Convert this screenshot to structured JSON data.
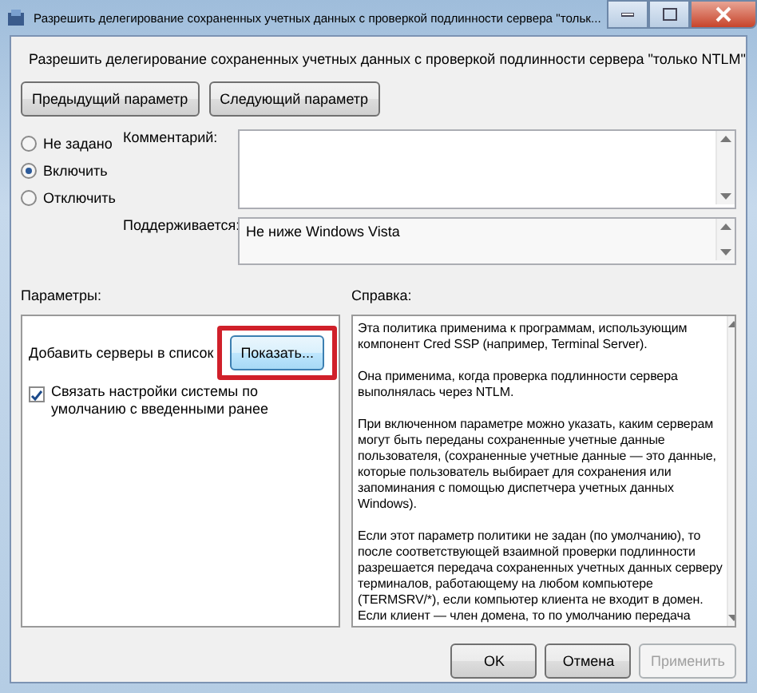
{
  "window": {
    "title": "Разрешить делегирование сохраненных учетных данных с проверкой подлинности сервера \"тольк..."
  },
  "header": {
    "title": "Разрешить делегирование сохраненных учетных данных с проверкой подлинности сервера \"только NTLM\""
  },
  "nav_buttons": [
    "Предыдущий параметр",
    "Следующий параметр"
  ],
  "state_options": [
    {
      "label": "Не задано",
      "selected": false
    },
    {
      "label": "Включить",
      "selected": true
    },
    {
      "label": "Отключить",
      "selected": false
    }
  ],
  "comment": {
    "label": "Комментарий:"
  },
  "supported": {
    "label": "Поддерживается:",
    "value": "Не ниже Windows Vista"
  },
  "parameters": {
    "label": "Параметры:",
    "servers_label": "Добавить серверы в список",
    "show_button": {
      "label": "Показать...",
      "highlighted": true
    },
    "merge": {
      "label": "Связать настройки системы по умолчанию с введенными ранее",
      "checked": true
    }
  },
  "help": {
    "label": "Справка:",
    "paragraphs": [
      "Эта политика применима к программам, использующим\nкомпонент Cred SSP (например, Terminal Server).",
      "Она применима, когда проверка подлинности сервера\nвыполнялась через NTLM.",
      "При включенном параметре можно указать, каким серверам\nмогут быть переданы сохраненные учетные данные\nпользователя, (сохраненные учетные данные — это данные,\nкоторые пользователь выбирает для сохранения или\nзапоминания с помощью диспетчера учетных данных\nWindows).",
      "Если этот параметр политики не задан (по умолчанию), то\nпосле соответствующей взаимной проверки подлинности\nразрешается передача сохраненных учетных данных серверу\nтерминалов, работающему на любом компьютере\n(TERMSRV/*), если компьютер клиента не входит в домен.\nЕсли клиент — член домена, то по умолчанию передача"
    ]
  },
  "footer_buttons": [
    {
      "label": "OK",
      "disabled": false
    },
    {
      "label": "Отмена",
      "disabled": false
    },
    {
      "label": "Применить",
      "disabled": true
    }
  ]
}
